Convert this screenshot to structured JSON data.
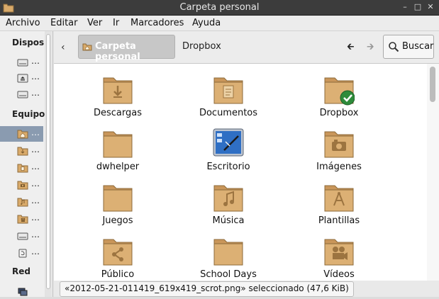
{
  "window": {
    "title": "Carpeta personal"
  },
  "menu": [
    "Archivo",
    "Editar",
    "Ver",
    "Ir",
    "Marcadores",
    "Ayuda"
  ],
  "sidebar": {
    "sections": {
      "devices": "Dispos",
      "computer": "Equipo",
      "network": "Red"
    },
    "devices": [
      "…",
      "…",
      "…"
    ],
    "computer": [
      "…",
      "…",
      "…",
      "…",
      "…",
      "…",
      "…",
      "…"
    ],
    "selected_index": 0
  },
  "toolbar": {
    "breadcrumbs": [
      "Carpeta personal",
      "Dropbox"
    ],
    "search_label": "Buscar"
  },
  "files": [
    {
      "name": "Descargas",
      "icon": "download-icon"
    },
    {
      "name": "Documentos",
      "icon": "document-icon"
    },
    {
      "name": "Dropbox",
      "icon": "dropbox-sync-check-icon"
    },
    {
      "name": "dwhelper",
      "icon": "folder-icon"
    },
    {
      "name": "Escritorio",
      "icon": "desktop-icon"
    },
    {
      "name": "Imágenes",
      "icon": "camera-icon"
    },
    {
      "name": "Juegos",
      "icon": "folder-icon"
    },
    {
      "name": "Música",
      "icon": "music-note-icon"
    },
    {
      "name": "Plantillas",
      "icon": "templates-icon"
    },
    {
      "name": "Público",
      "icon": "share-icon"
    },
    {
      "name": "School Days",
      "icon": "folder-icon"
    },
    {
      "name": "Vídeos",
      "icon": "film-camera-icon"
    }
  ],
  "status": "«2012-05-21-011419_619x419_scrot.png» seleccionado (47,6 KiB)",
  "colors": {
    "titlebar": "#3c3c3c",
    "selection": "#8a9bb0",
    "folder": "#d9aa6a",
    "check": "#2e8b3a"
  }
}
